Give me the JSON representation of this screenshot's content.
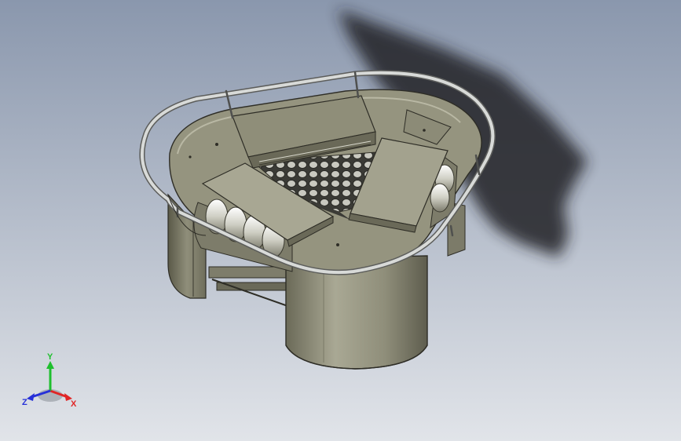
{
  "viewport": {
    "background_top": "#8a97ad",
    "background_bottom": "#e1e4e9",
    "shadow_color": "#1e2124"
  },
  "model": {
    "body_color": "#8e8d78",
    "body_light": "#b2b19d",
    "body_dark": "#5f5e4f",
    "rail_color": "#c9cbc9",
    "mesh_color": "#3b3b36"
  },
  "triad": {
    "x_label": "X",
    "y_label": "Y",
    "z_label": "Z",
    "x_color": "#e02626",
    "y_color": "#1fbf2e",
    "z_color": "#2630d8"
  }
}
